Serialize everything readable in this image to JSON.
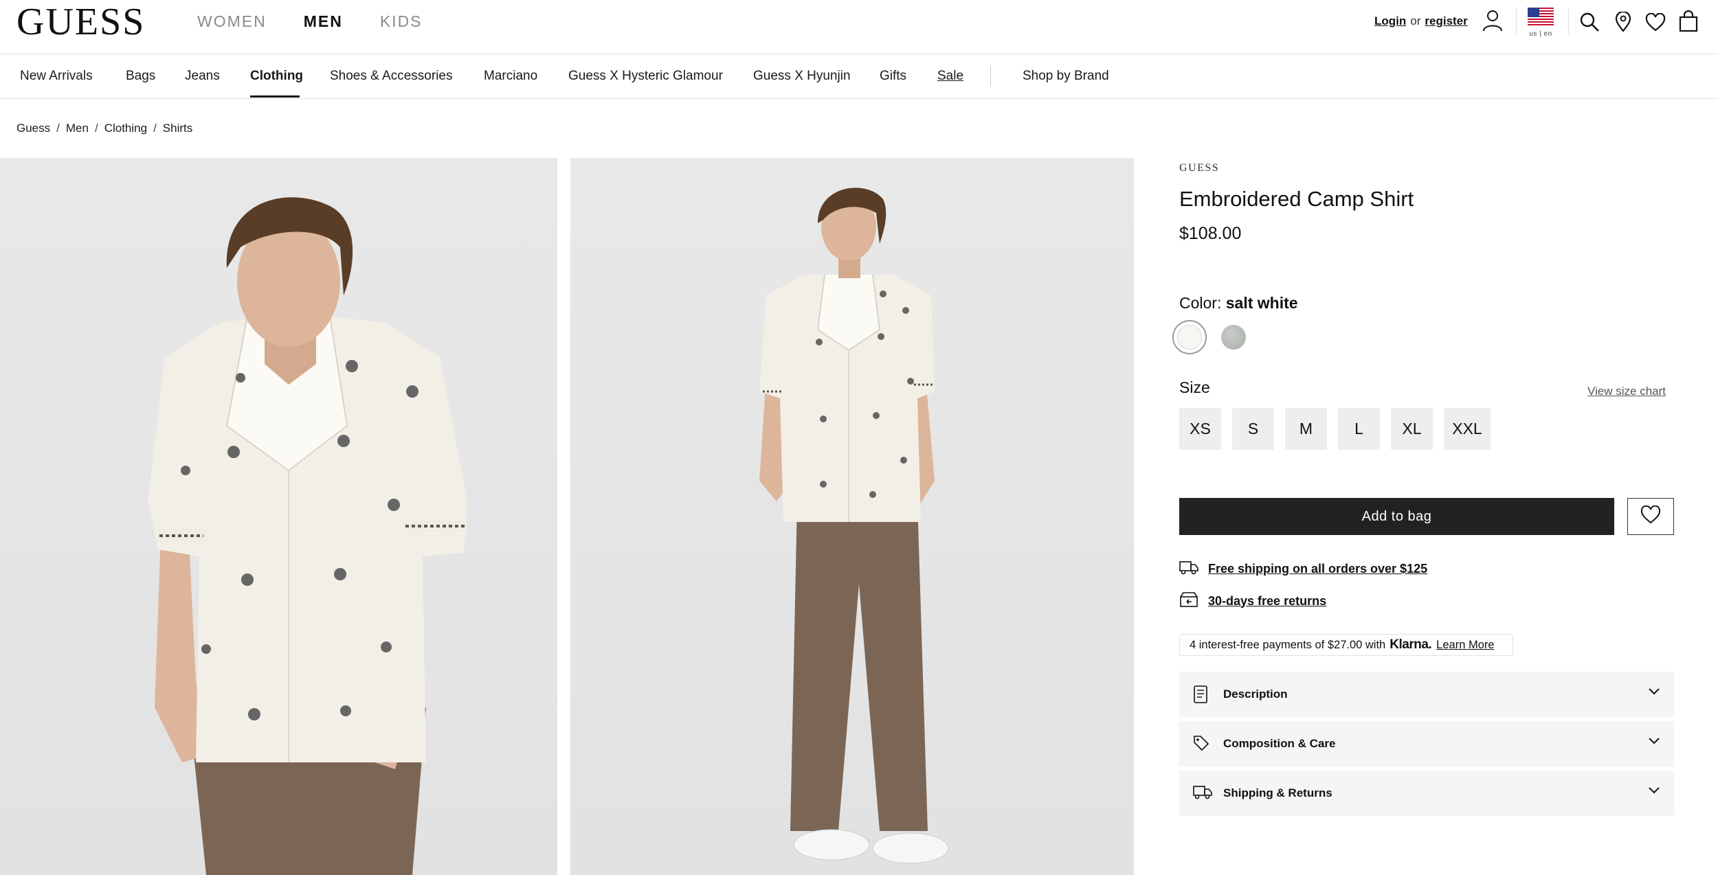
{
  "header": {
    "logo": "GUESS",
    "gender_tabs": [
      {
        "label": "WOMEN",
        "active": false
      },
      {
        "label": "MEN",
        "active": true
      },
      {
        "label": "KIDS",
        "active": false
      }
    ],
    "account": {
      "login": "Login",
      "or": "or",
      "register": "register"
    },
    "locale": "us | en",
    "icons": [
      "user-icon",
      "us-flag-icon",
      "search-icon",
      "location-pin-icon",
      "heart-icon",
      "shopping-bag-icon"
    ]
  },
  "catnav": {
    "items": [
      {
        "label": "New Arrivals"
      },
      {
        "label": "Bags"
      },
      {
        "label": "Jeans"
      },
      {
        "label": "Clothing",
        "active": true
      },
      {
        "label": "Shoes & Accessories"
      },
      {
        "label": "Marciano"
      },
      {
        "label": "Guess X Hysteric Glamour"
      },
      {
        "label": "Guess X Hyunjin"
      },
      {
        "label": "Gifts"
      },
      {
        "label": "Sale"
      },
      {
        "label": "Shop by Brand"
      }
    ]
  },
  "breadcrumb": [
    "Guess",
    "Men",
    "Clothing",
    "Shirts"
  ],
  "product": {
    "brand": "GUESS",
    "title": "Embroidered Camp Shirt",
    "price": "$108.00",
    "color_label": "Color:",
    "color_value": "salt white",
    "swatches": [
      {
        "name": "salt white",
        "color": "#f6f6f3",
        "selected": true
      },
      {
        "name": "grey",
        "color": "#b8bcb8",
        "selected": false
      }
    ],
    "size_label": "Size",
    "size_chart_link": "View size chart",
    "sizes": [
      "XS",
      "S",
      "M",
      "L",
      "XL",
      "XXL"
    ],
    "add_to_bag": "Add to bag",
    "perks": [
      {
        "icon": "truck-icon",
        "text": "Free shipping on all orders over $125"
      },
      {
        "icon": "return-box-icon",
        "text": "30-days free returns"
      }
    ],
    "klarna": {
      "text": "4 interest-free payments of $27.00 with",
      "brand": "Klarna.",
      "learn_more": "Learn More"
    },
    "accordions": [
      {
        "icon": "document-icon",
        "label": "Description"
      },
      {
        "icon": "tag-icon",
        "label": "Composition & Care"
      },
      {
        "icon": "truck-icon",
        "label": "Shipping & Returns"
      }
    ]
  },
  "colors": {
    "primary": "#222222",
    "muted_text": "#8a8a8a",
    "panel_bg": "#f5f5f5",
    "image_bg": "#e6e6e6"
  }
}
